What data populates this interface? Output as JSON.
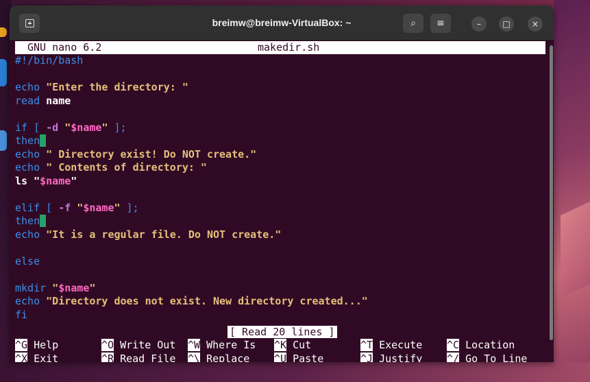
{
  "window": {
    "title": "breimw@breimw-VirtualBox: ~",
    "buttons": {
      "new_tab": "new-tab-icon",
      "search": "⌕",
      "menu": "≡",
      "minimize": "–",
      "maximize": "□",
      "close": "×"
    }
  },
  "nano": {
    "version": "GNU nano 6.2",
    "filename": "makedir.sh",
    "status": "[ Read 20 lines ]"
  },
  "code": {
    "l1": "#!/bin/bash",
    "l3_kw": "echo",
    "l3_str": " \"Enter the directory: \"",
    "l4_kw": "read",
    "l4_rest": " name",
    "l6_kw": "if [",
    "l6_opt": " -d",
    "l6_s1": " \"",
    "l6_var": "$name",
    "l6_s2": "\"",
    "l6_end": " ];",
    "l7": "then",
    "l8_kw": "echo",
    "l8_str": " \" Directory exist! Do NOT create.\"",
    "l9_kw": "echo",
    "l9_str": " \" Contents of directory: \"",
    "l10_a": "ls \"",
    "l10_var": "$name",
    "l10_b": "\"",
    "l12_kw": "elif [",
    "l12_opt": " -f",
    "l12_s1": " \"",
    "l12_var": "$name",
    "l12_s2": "\"",
    "l12_end": " ];",
    "l13": "then",
    "l14_kw": "echo",
    "l14_str": " \"It is a regular file. Do NOT create.\"",
    "l16": "else",
    "l18_kw": "mkdir",
    "l18_s1": " \"",
    "l18_var": "$name",
    "l18_s2": "\"",
    "l19_kw": "echo",
    "l19_str": " \"Directory does not exist. New directory created...\"",
    "l20": "fi"
  },
  "shortcuts": [
    {
      "key": "^G",
      "label": "Help"
    },
    {
      "key": "^O",
      "label": "Write Out"
    },
    {
      "key": "^W",
      "label": "Where Is"
    },
    {
      "key": "^K",
      "label": "Cut"
    },
    {
      "key": "^T",
      "label": "Execute"
    },
    {
      "key": "^C",
      "label": "Location"
    },
    {
      "key": "^X",
      "label": "Exit"
    },
    {
      "key": "^R",
      "label": "Read File"
    },
    {
      "key": "^\\",
      "label": "Replace"
    },
    {
      "key": "^U",
      "label": "Paste"
    },
    {
      "key": "^J",
      "label": "Justify"
    },
    {
      "key": "^/",
      "label": "Go To Line"
    }
  ],
  "colors": {
    "terminal_bg": "#300a24",
    "keyword": "#3b8eea",
    "string": "#e5c07b",
    "variable": "#ff6ac1",
    "option": "#c678dd",
    "cursor": "#26a269"
  }
}
